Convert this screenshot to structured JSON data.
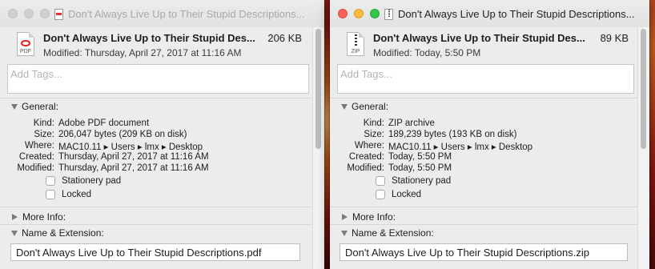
{
  "windows": [
    {
      "title": "Don't Always Live Up to Their Stupid Descriptions...",
      "file_name_short": "Don't Always Live Up to Their Stupid Des...",
      "size": "206 KB",
      "icon_label": "PDF",
      "modified": "Modified: Thursday, April 27, 2017 at 11:16 AM",
      "tags_placeholder": "Add Tags...",
      "general_label": "General:",
      "info": [
        {
          "key": "Kind:",
          "value": "Adobe PDF document"
        },
        {
          "key": "Size:",
          "value": "206,047 bytes (209 KB on disk)"
        },
        {
          "key": "Where:",
          "value": "MAC10.11 ▸ Users ▸ lmx ▸ Desktop"
        },
        {
          "key": "Created:",
          "value": "Thursday, April 27, 2017 at 11:16 AM"
        },
        {
          "key": "Modified:",
          "value": "Thursday, April 27, 2017 at 11:16 AM"
        }
      ],
      "stationery_label": "Stationery pad",
      "locked_label": "Locked",
      "more_info_label": "More Info:",
      "name_ext_label": "Name & Extension:",
      "name_value": "Don't Always Live Up to Their Stupid Descriptions.pdf"
    },
    {
      "title": "Don't Always Live Up to Their Stupid Descriptions...",
      "file_name_short": "Don't Always Live Up to Their Stupid Des...",
      "size": "89 KB",
      "icon_label": "ZIP",
      "modified": "Modified: Today, 5:50 PM",
      "tags_placeholder": "Add Tags...",
      "general_label": "General:",
      "info": [
        {
          "key": "Kind:",
          "value": "ZIP archive"
        },
        {
          "key": "Size:",
          "value": "189,239 bytes (193 KB on disk)"
        },
        {
          "key": "Where:",
          "value": "MAC10.11 ▸ Users ▸ lmx ▸ Desktop"
        },
        {
          "key": "Created:",
          "value": "Today, 5:50 PM"
        },
        {
          "key": "Modified:",
          "value": "Today, 5:50 PM"
        }
      ],
      "stationery_label": "Stationery pad",
      "locked_label": "Locked",
      "more_info_label": "More Info:",
      "name_ext_label": "Name & Extension:",
      "name_value": "Don't Always Live Up to Their Stupid Descriptions.zip"
    }
  ]
}
